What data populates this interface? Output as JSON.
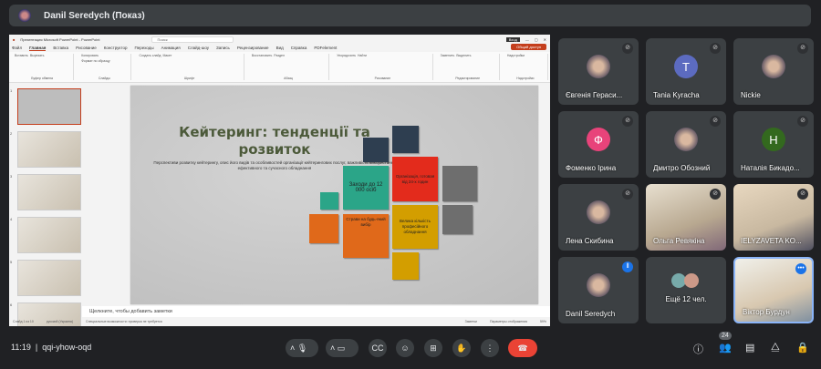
{
  "presenter_bar": {
    "title": "Danil Seredych (Показ)"
  },
  "powerpoint": {
    "window_title": "Презентация Microsoft PowerPoint - PowerPoint",
    "search_placeholder": "Поиск",
    "window_button": "Вход",
    "share_label": "Общий доступ",
    "tabs": [
      "Файл",
      "Главная",
      "Вставка",
      "Рисование",
      "Конструктор",
      "Переходы",
      "Анимация",
      "Слайд-шоу",
      "Запись",
      "Рецензирование",
      "Вид",
      "Справка",
      "PDFelement"
    ],
    "ribbon_groups": [
      "Буфер обмена",
      "Слайды",
      "Шрифт",
      "Абзац",
      "Рисование",
      "Редактирование",
      "Надстройки"
    ],
    "ribbon_buttons": [
      "Вставить",
      "Вырезать",
      "Копировать",
      "Формат по образцу",
      "Создать слайд",
      "Макет",
      "Восстановить",
      "Раздел",
      "Упорядочить",
      "Найти",
      "Заменить",
      "Выделить",
      "Надстройки"
    ],
    "slide_numbers": [
      "1",
      "2",
      "3",
      "4",
      "5",
      "6"
    ],
    "slide": {
      "title": "Кейтеринг: тенденції та розвиток",
      "subtitle": "Перспективи розвитку кейтерингу, опис його видів та особливостей організації кейтерингових послуг, важливість використання ефективного та сучасного обладнання",
      "blocks": [
        "Заходи до 12 000 осіб",
        "Організація, готовая від 24-х годин",
        "Страви на будь-який вибір",
        "Велика кількість професійного обладнання"
      ]
    },
    "notes_placeholder": "Щелкните, чтобы добавить заметки",
    "status": {
      "slide": "Слайд 1 из 10",
      "language": "русский (Украина)",
      "accessibility": "Специальные возможности: проверка не требуется",
      "notes": "Заметки",
      "comments": "Параметры отображения",
      "zoom": "59%"
    },
    "colors": {
      "accent": "#c43e1c",
      "navy": "#2e3e50",
      "teal": "#2ba588",
      "red": "#e32b1c",
      "gray": "#6e6e6e",
      "orange": "#e0691a",
      "yellow": "#d39e00"
    }
  },
  "participants": [
    {
      "name": "Євгенія Гераси...",
      "muted": true,
      "avatar": "photo"
    },
    {
      "name": "Tania Kyracha",
      "muted": true,
      "avatar": "letter",
      "letter": "T",
      "color": "#5c6bc0"
    },
    {
      "name": "Nickie",
      "muted": true,
      "avatar": "photo"
    },
    {
      "name": "Фоменко Ірина",
      "muted": true,
      "avatar": "letter",
      "letter": "Ф",
      "color": "#e8437a"
    },
    {
      "name": "Дмитро Обозний",
      "muted": true,
      "avatar": "photo"
    },
    {
      "name": "Наталія Бикадо...",
      "muted": true,
      "avatar": "letter",
      "letter": "Н",
      "color": "#33691e"
    },
    {
      "name": "Лена Скибина",
      "muted": true,
      "avatar": "photo"
    },
    {
      "name": "Ольга Ревякіна",
      "muted": true,
      "avatar": "video"
    },
    {
      "name": "IELYZAVETA KO...",
      "muted": true,
      "avatar": "video"
    },
    {
      "name": "Danil Seredych",
      "muted": false,
      "avatar": "photo",
      "speaking": true
    },
    {
      "name": "Ещё 12 чел.",
      "muted": false,
      "avatar": "group"
    },
    {
      "name": "Віктор Бурдун",
      "muted": false,
      "avatar": "video",
      "self": true
    }
  ],
  "bottom_bar": {
    "time": "11:19",
    "meeting_code": "qqi-yhow-oqd",
    "participant_count": "24"
  }
}
